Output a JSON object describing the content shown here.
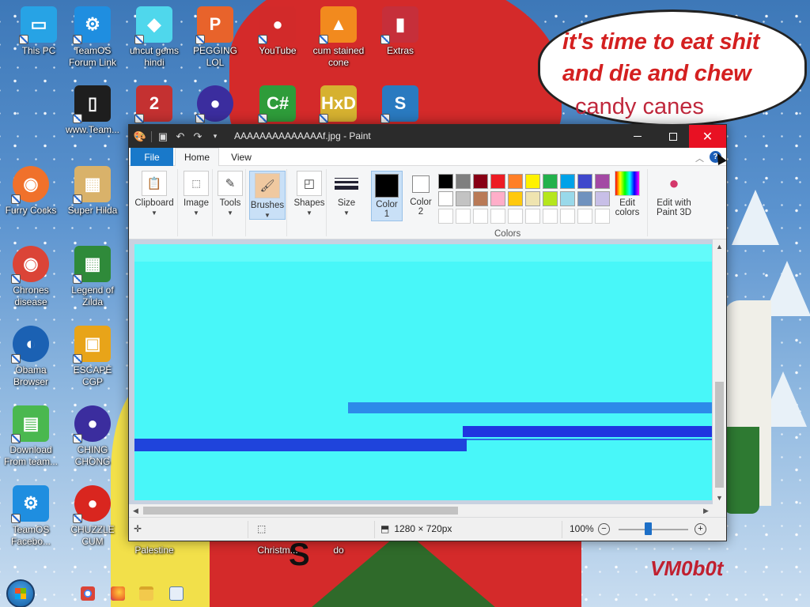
{
  "wallpaper": {
    "speech_line1": "it's time to eat shit",
    "speech_line2": "and die and chew",
    "speech_line3": "candy canes",
    "watermark": "VM0b0t",
    "belly_letter": "S"
  },
  "desktop_icons": [
    {
      "label": "This PC",
      "icon": "computer-icon",
      "color": "#27a3e5"
    },
    {
      "label": "TeamOS Forum Link",
      "icon": "gear-icon",
      "color": "#1f8ee0"
    },
    {
      "label": "uncut gems hindi",
      "icon": "gem-icon",
      "color": "#4fd7ec"
    },
    {
      "label": "PEGGING LOL",
      "icon": "p-logo-icon",
      "color": "#e8632b"
    },
    {
      "label": "YouTube",
      "icon": "angry-bird-icon",
      "color": "#d22a2a"
    },
    {
      "label": "cum stained cone",
      "icon": "traffic-cone-icon",
      "color": "#f28a1e"
    },
    {
      "label": "Extras",
      "icon": "card-pack-icon",
      "color": "#c62f3a"
    },
    {
      "label": "www.Team...",
      "icon": "book-icon",
      "color": "#1e1e1e"
    },
    {
      "label": "",
      "icon": "number-two-icon",
      "color": "#c43131"
    },
    {
      "label": "",
      "icon": "sphere-icon",
      "color": "#3b2d9e"
    },
    {
      "label": "",
      "icon": "csharp-icon",
      "color": "#2e9c3a"
    },
    {
      "label": "",
      "icon": "hxd-icon",
      "color": "#d6b130"
    },
    {
      "label": "",
      "icon": "wg-icon",
      "color": "#2a7ac0"
    },
    {
      "label": "Furry Cocks",
      "icon": "firefox-icon",
      "color": "#f0712b"
    },
    {
      "label": "Super Hilda",
      "icon": "pixel-dog-icon",
      "color": "#d9b26a"
    },
    {
      "label": "Chrones disease",
      "icon": "chrome-icon",
      "color": "#db4437"
    },
    {
      "label": "Legend of Zilda",
      "icon": "pixel-hero-icon",
      "color": "#2f8a3a"
    },
    {
      "label": "Obama Browser",
      "icon": "obama-logo-icon",
      "color": "#1b61b3"
    },
    {
      "label": "ESCAPE CGP",
      "icon": "chinese-seal-icon",
      "color": "#e8a419"
    },
    {
      "label": "Download From team...",
      "icon": "notepad-icon",
      "color": "#4ab84f"
    },
    {
      "label": "CHING CHONG",
      "icon": "sphere-icon",
      "color": "#3b2d9e"
    },
    {
      "label": "TeamOS Facebo...",
      "icon": "gear-icon",
      "color": "#1f8ee0"
    },
    {
      "label": "CHUZZLE CUM",
      "icon": "chuzzle-icon",
      "color": "#d9261f"
    },
    {
      "label": "Palestine",
      "icon": "partial-icon",
      "color": "#7a7a7a"
    },
    {
      "label": "Christm...",
      "icon": "partial-icon",
      "color": "#7a7a7a"
    },
    {
      "label": "do",
      "icon": "partial-icon",
      "color": "#7a7a7a"
    }
  ],
  "window": {
    "title": "AAAAAAAAAAAAAAf.jpg - Paint",
    "qat": {
      "save_icon": "save-icon",
      "undo_icon": "undo-icon",
      "redo_icon": "redo-icon",
      "customize_icon": "chevron-down-icon"
    }
  },
  "tabs": {
    "file": "File",
    "home": "Home",
    "view": "View"
  },
  "ribbon": {
    "clipboard": "Clipboard",
    "image": "Image",
    "tools": "Tools",
    "brushes": "Brushes",
    "shapes": "Shapes",
    "size": "Size",
    "color1_a": "Color",
    "color1_b": "1",
    "color2_a": "Color",
    "color2_b": "2",
    "edit_colors_a": "Edit",
    "edit_colors_b": "colors",
    "paint3d_a": "Edit with",
    "paint3d_b": "Paint 3D",
    "colors_group": "Colors"
  },
  "colors": {
    "color1": "#000000",
    "color2": "#ffffff",
    "palette_row1": [
      "#000000",
      "#7f7f7f",
      "#880015",
      "#ed1c24",
      "#ff7f27",
      "#fff200",
      "#22b14c",
      "#00a2e8",
      "#3f48cc",
      "#a349a4"
    ],
    "palette_row2": [
      "#ffffff",
      "#c3c3c3",
      "#b97a57",
      "#ffaec9",
      "#ffc90e",
      "#efe4b0",
      "#b5e61d",
      "#99d9ea",
      "#7092be",
      "#c8bfe7"
    ]
  },
  "status": {
    "dimensions": "1280 × 720px",
    "zoom": "100%",
    "zoom_level": 0.42
  }
}
